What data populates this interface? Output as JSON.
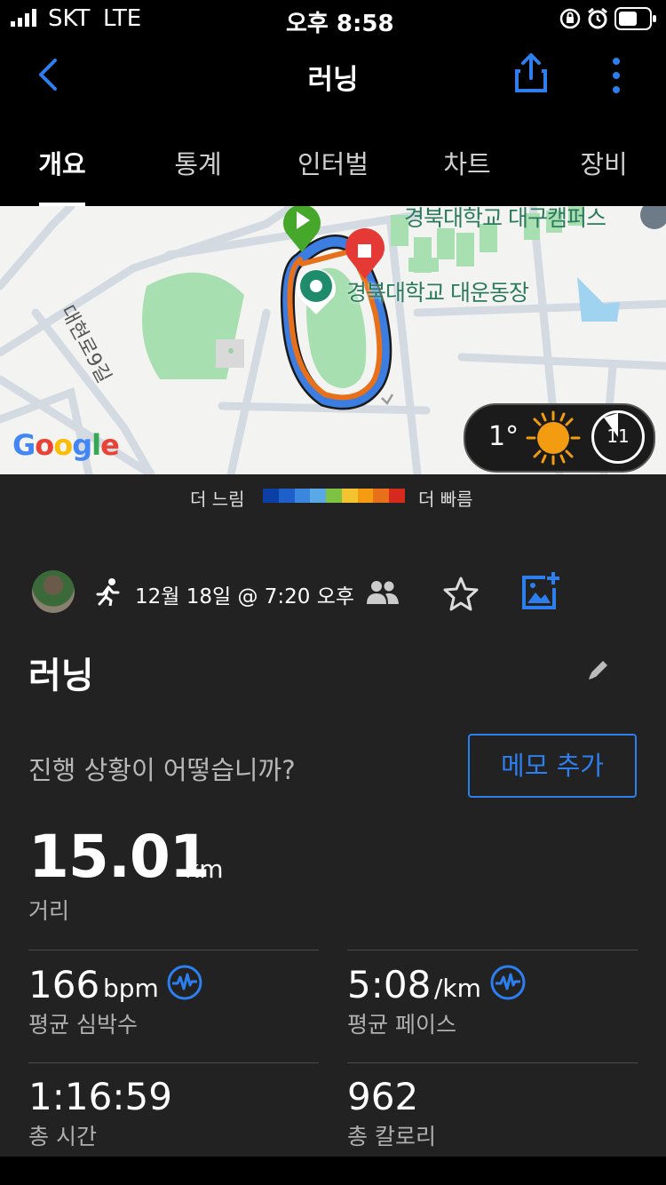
{
  "status_bar": {
    "carrier": "SKT",
    "network": "LTE",
    "time": "오후 8:58"
  },
  "nav": {
    "title": "러닝"
  },
  "tabs": [
    {
      "label": "개요",
      "active": true
    },
    {
      "label": "통계",
      "active": false
    },
    {
      "label": "인터벌",
      "active": false
    },
    {
      "label": "차트",
      "active": false
    },
    {
      "label": "장비",
      "active": false
    }
  ],
  "map": {
    "road_label": "대현로9길",
    "place_label": "경북대학교 대운동장",
    "place_label_top": "경북대학교 대구캠퍼스",
    "logo": "Google",
    "weather": {
      "temperature": "1°",
      "icon": "sun-icon",
      "wind_speed": "11"
    }
  },
  "legend": {
    "slow": "더 느림",
    "fast": "더 빠름",
    "colors": [
      "#0b3fa3",
      "#1f5fc9",
      "#3b87de",
      "#5aa9e6",
      "#7dc242",
      "#f4c430",
      "#f39c12",
      "#e8701a",
      "#d62a1e"
    ]
  },
  "activity": {
    "date": "12월 18일 @ 7:20 오후",
    "name": "러닝",
    "prompt": "진행 상황이 어떻습니까?",
    "memo_button": "메모 추가"
  },
  "stats": {
    "distance": {
      "value": "15.01",
      "unit": "km",
      "label": "거리"
    },
    "avg_hr": {
      "value": "166",
      "unit": "bpm",
      "label": "평균 심박수"
    },
    "avg_pace": {
      "value": "5:08",
      "unit": "/km",
      "label": "평균 페이스"
    },
    "total_time": {
      "value": "1:16:59",
      "label": "총 시간"
    },
    "calories": {
      "value": "962",
      "label": "총 칼로리"
    }
  },
  "colors": {
    "accent": "#2d7ff0",
    "panel": "#222222",
    "start": "#46a82a",
    "stop": "#e53935"
  }
}
